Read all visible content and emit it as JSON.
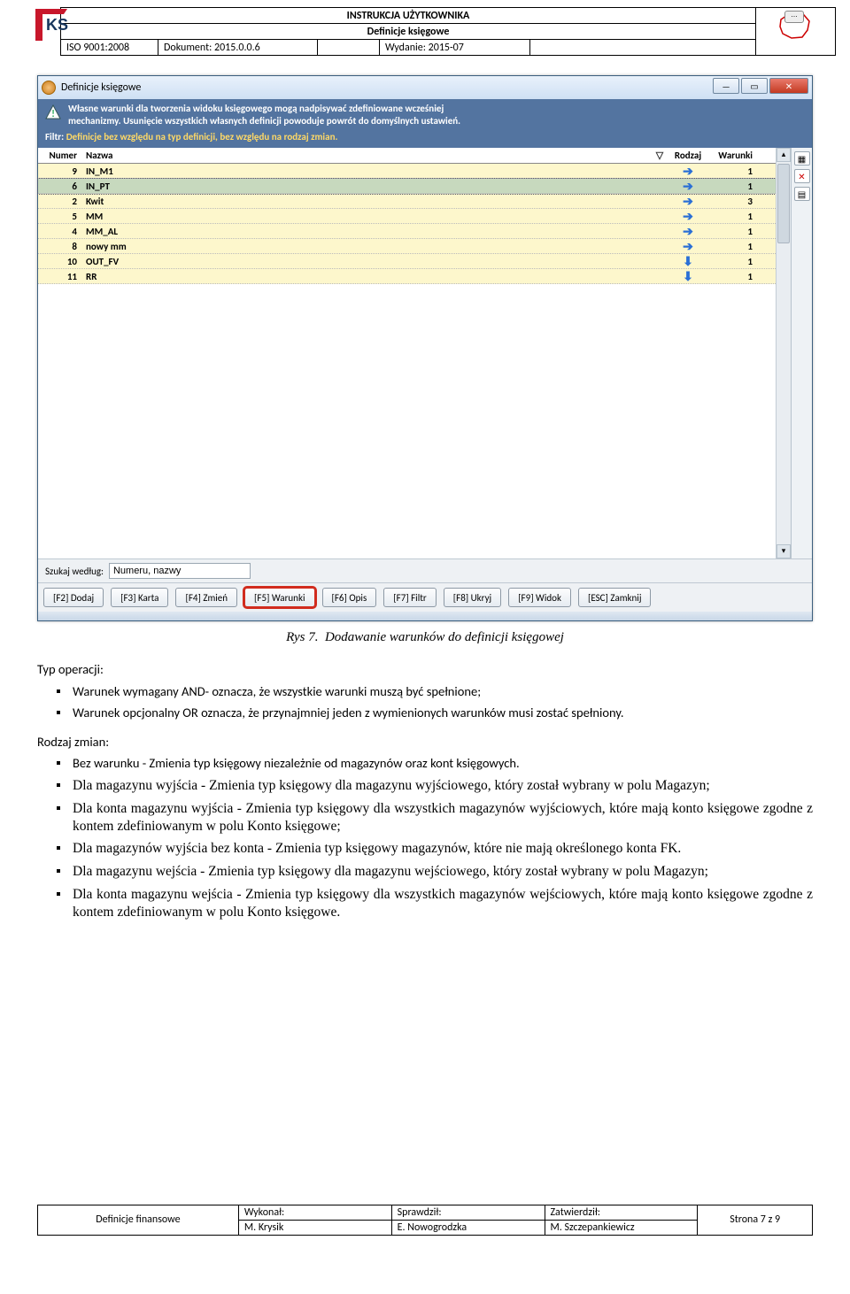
{
  "header": {
    "title": "INSTRUKCJA UŻYTKOWNIKA",
    "subtitle": "Definicje księgowe",
    "iso": "ISO 9001:2008",
    "doc_lbl": "Dokument: 2015.0.0.6",
    "wyd_lbl": "Wydanie: 2015-07"
  },
  "window": {
    "title": "Definicje księgowe",
    "msg1": "Własne warunki dla tworzenia widoku księgowego mogą nadpisywać zdefiniowane wcześniej",
    "msg2": "mechanizmy. Usunięcie wszystkich własnych definicji powoduje powrót do domyślnych ustawień.",
    "filt_lbl": "Filtr:",
    "filt_txt": "Definicje bez względu na typ definicji, bez względu na rodzaj zmian.",
    "cols": {
      "numer": "Numer",
      "nazwa": "Nazwa",
      "rodzaj": "Rodzaj",
      "warunki": "Warunki"
    },
    "rows": [
      {
        "num": "9",
        "name": "IN_M1",
        "dir": "right",
        "war": "1",
        "cls": "yellow"
      },
      {
        "num": "6",
        "name": "IN_PT",
        "dir": "right",
        "war": "1",
        "cls": "sel"
      },
      {
        "num": "2",
        "name": "Kwit",
        "dir": "right",
        "war": "3",
        "cls": "yellow"
      },
      {
        "num": "5",
        "name": "MM",
        "dir": "right",
        "war": "1",
        "cls": "yellow"
      },
      {
        "num": "4",
        "name": "MM_AL",
        "dir": "right",
        "war": "1",
        "cls": "yellow"
      },
      {
        "num": "8",
        "name": "nowy mm",
        "dir": "right",
        "war": "1",
        "cls": "yellow"
      },
      {
        "num": "10",
        "name": "OUT_FV",
        "dir": "down",
        "war": "1",
        "cls": "yellow"
      },
      {
        "num": "11",
        "name": "RR",
        "dir": "down",
        "war": "1",
        "cls": "yellow"
      }
    ],
    "search_lbl": "Szukaj według:",
    "search_val": "Numeru, nazwy",
    "buttons": {
      "f2": "[F2] Dodaj",
      "f3": "[F3] Karta",
      "f4": "[F4] Zmień",
      "f5": "[F5] Warunki",
      "f6": "[F6] Opis",
      "f7": "[F7] Filtr",
      "f8": "[F8] Ukryj",
      "f9": "[F9] Widok",
      "esc": "[ESC] Zamknij"
    }
  },
  "caption": {
    "rys": "Rys 7.",
    "txt": "Dodawanie warunków do definicji księgowej"
  },
  "section1_label": "Typ operacji:",
  "bul1": [
    "Warunek wymagany AND- oznacza, że wszystkie warunki muszą być spełnione;",
    "Warunek opcjonalny OR oznacza, że przynajmniej jeden z wymienionych warunków musi zostać spełniony."
  ],
  "section2_label": "Rodzaj zmian:",
  "bul2": [
    {
      "cls": "cal",
      "t": "Bez warunku - Zmienia typ księgowy niezależnie od magazynów oraz kont księgowych."
    },
    {
      "cls": "ser",
      "t": "Dla magazynu wyjścia - Zmienia typ księgowy dla magazynu wyjściowego, który został wybrany w polu Magazyn;"
    },
    {
      "cls": "ser",
      "t": "Dla konta magazynu wyjścia - Zmienia typ księgowy dla wszystkich magazynów wyjściowych, które mają konto księgowe zgodne z kontem zdefiniowanym w polu Konto księgowe;"
    },
    {
      "cls": "ser",
      "t": "Dla magazynów wyjścia bez konta - Zmienia typ księgowy magazynów, które nie mają określonego konta FK."
    },
    {
      "cls": "ser",
      "t": "Dla magazynu wejścia - Zmienia typ księgowy dla magazynu wejściowego, który został wybrany w polu Magazyn;"
    },
    {
      "cls": "ser",
      "t": "Dla konta magazynu wejścia - Zmienia typ księgowy dla wszystkich magazynów wejściowych, które mają konto księgowe zgodne z kontem zdefiniowanym w polu Konto księgowe."
    }
  ],
  "footer": {
    "left": "Definicje finansowe",
    "c1a": "Wykonał:",
    "c1b": "M. Krysik",
    "c2a": "Sprawdził:",
    "c2b": "E. Nowogrodzka",
    "c3a": "Zatwierdził:",
    "c3b": "M. Szczepankiewicz",
    "page": "Strona 7 z 9"
  }
}
